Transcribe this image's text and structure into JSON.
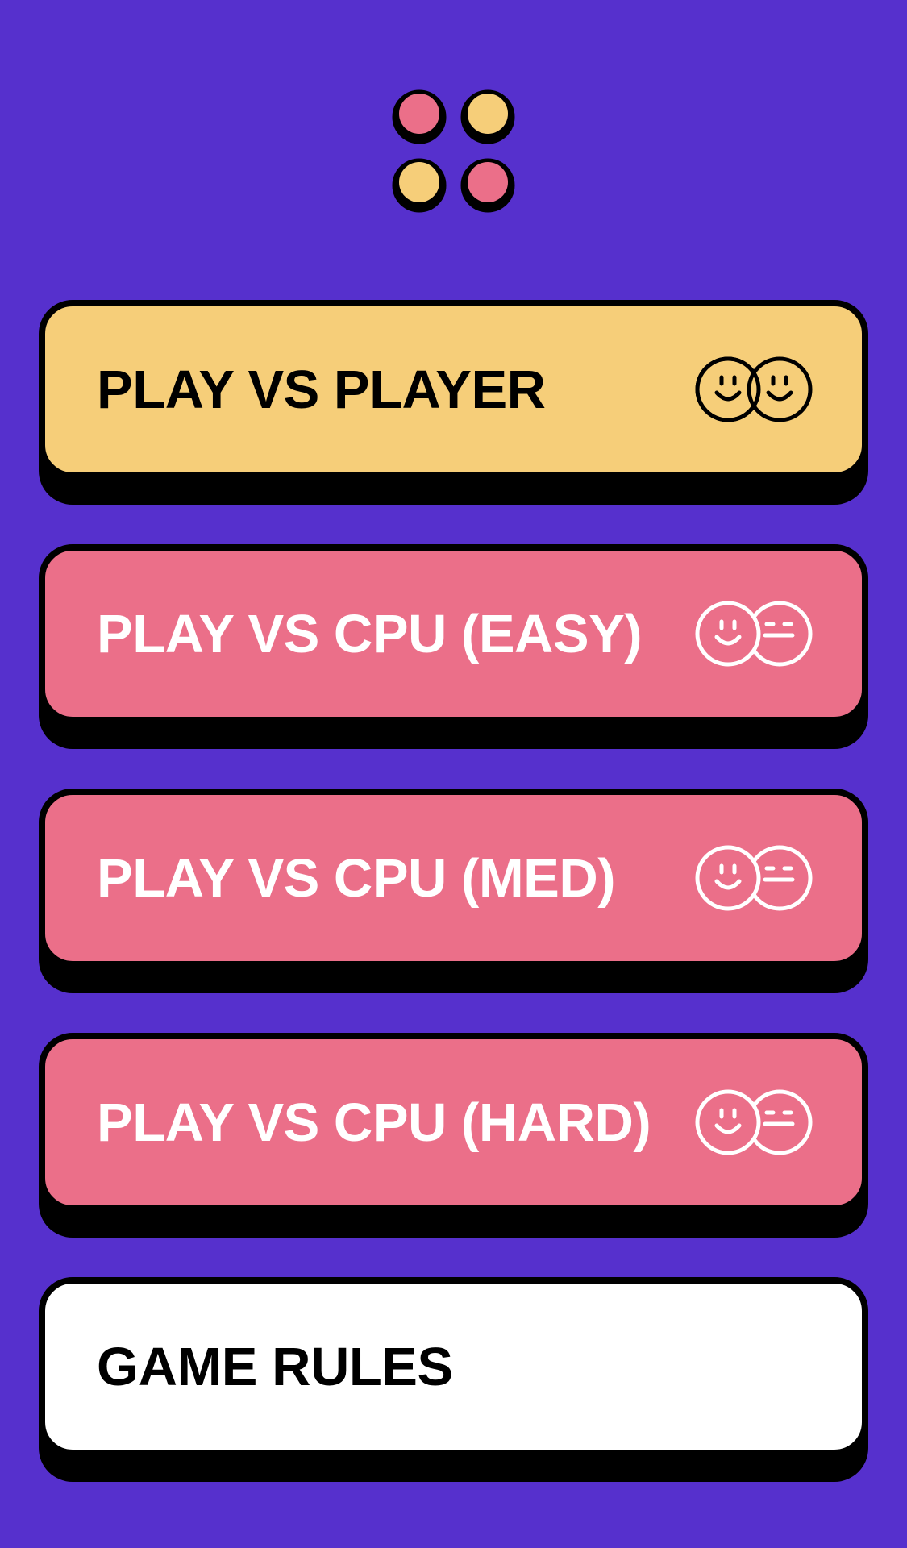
{
  "logo": {
    "icon": "connect-four-logo-icon",
    "colors": [
      "#eb6f89",
      "#f6ce79",
      "#f6ce79",
      "#eb6f89"
    ]
  },
  "menu": {
    "buttons": [
      {
        "label": "PLAY VS PLAYER",
        "icon": "two-smiley-faces-icon",
        "background": "#f6ce79",
        "text_color": "#000000"
      },
      {
        "label": "PLAY VS CPU (EASY)",
        "icon": "smiley-and-robot-face-icon",
        "background": "#eb6f89",
        "text_color": "#ffffff"
      },
      {
        "label": "PLAY VS CPU (MED)",
        "icon": "smiley-and-robot-face-icon",
        "background": "#eb6f89",
        "text_color": "#ffffff"
      },
      {
        "label": "PLAY VS CPU (HARD)",
        "icon": "smiley-and-robot-face-icon",
        "background": "#eb6f89",
        "text_color": "#ffffff"
      },
      {
        "label": "GAME RULES",
        "background": "#ffffff",
        "text_color": "#000000"
      }
    ]
  },
  "colors": {
    "background": "#5630cd",
    "outline": "#000000"
  }
}
